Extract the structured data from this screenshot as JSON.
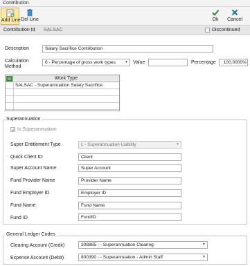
{
  "window": {
    "title": "Contribution"
  },
  "toolbar": {
    "add_line": "Add Line",
    "del_line": "Del Line",
    "ok": "Ok",
    "cancel": "Cancel"
  },
  "idbar": {
    "label": "Contribution Id",
    "value": "SALSAC",
    "discontinued_label": "Discontinued"
  },
  "form": {
    "description_label": "Description",
    "description_value": "Salary Sacrifice Contribution",
    "calc_label_1": "Calculation",
    "calc_label_2": "Method",
    "calc_value": "6 - Percentage of gross work types",
    "value_label": "Value",
    "value_value": "",
    "percentage_label": "Percentage",
    "percentage_value": "100.0000%"
  },
  "grid": {
    "header": "Work Type",
    "rows": [
      "SALSAC - Superannuation Salary Sacrifice",
      "",
      "",
      "",
      ""
    ]
  },
  "superannuation": {
    "title": "Superannuation",
    "is_super_label": "Is Superannuation",
    "is_super_checked": true,
    "fields": [
      {
        "label": "Super Entitlement Type",
        "value": "L - Superannuation Liability"
      },
      {
        "label": "Quick Client ID",
        "value": "Client"
      },
      {
        "label": "Super Account Name",
        "value": "Super Account"
      },
      {
        "label": "Fund Provider Name",
        "value": "Provider Name"
      },
      {
        "label": "Fund Employer ID",
        "value": "Employer ID"
      },
      {
        "label": "Fund Name",
        "value": "Fund Name"
      },
      {
        "label": "Fund ID",
        "value": "FundID"
      }
    ]
  },
  "gl": {
    "title": "General Ledger Codes",
    "clearing_label": "Clearing Account (Credit)",
    "clearing_value": "308885 -  - Superannuation Clearing",
    "expense_label": "Expense Account (Debit)",
    "expense_value": "800390 -  - Superannuation - Admin Staff"
  },
  "colors": {
    "ok_check": "#2e8b3a",
    "cancel_x": "#1b6fb3",
    "highlight": "#fde8a2"
  }
}
